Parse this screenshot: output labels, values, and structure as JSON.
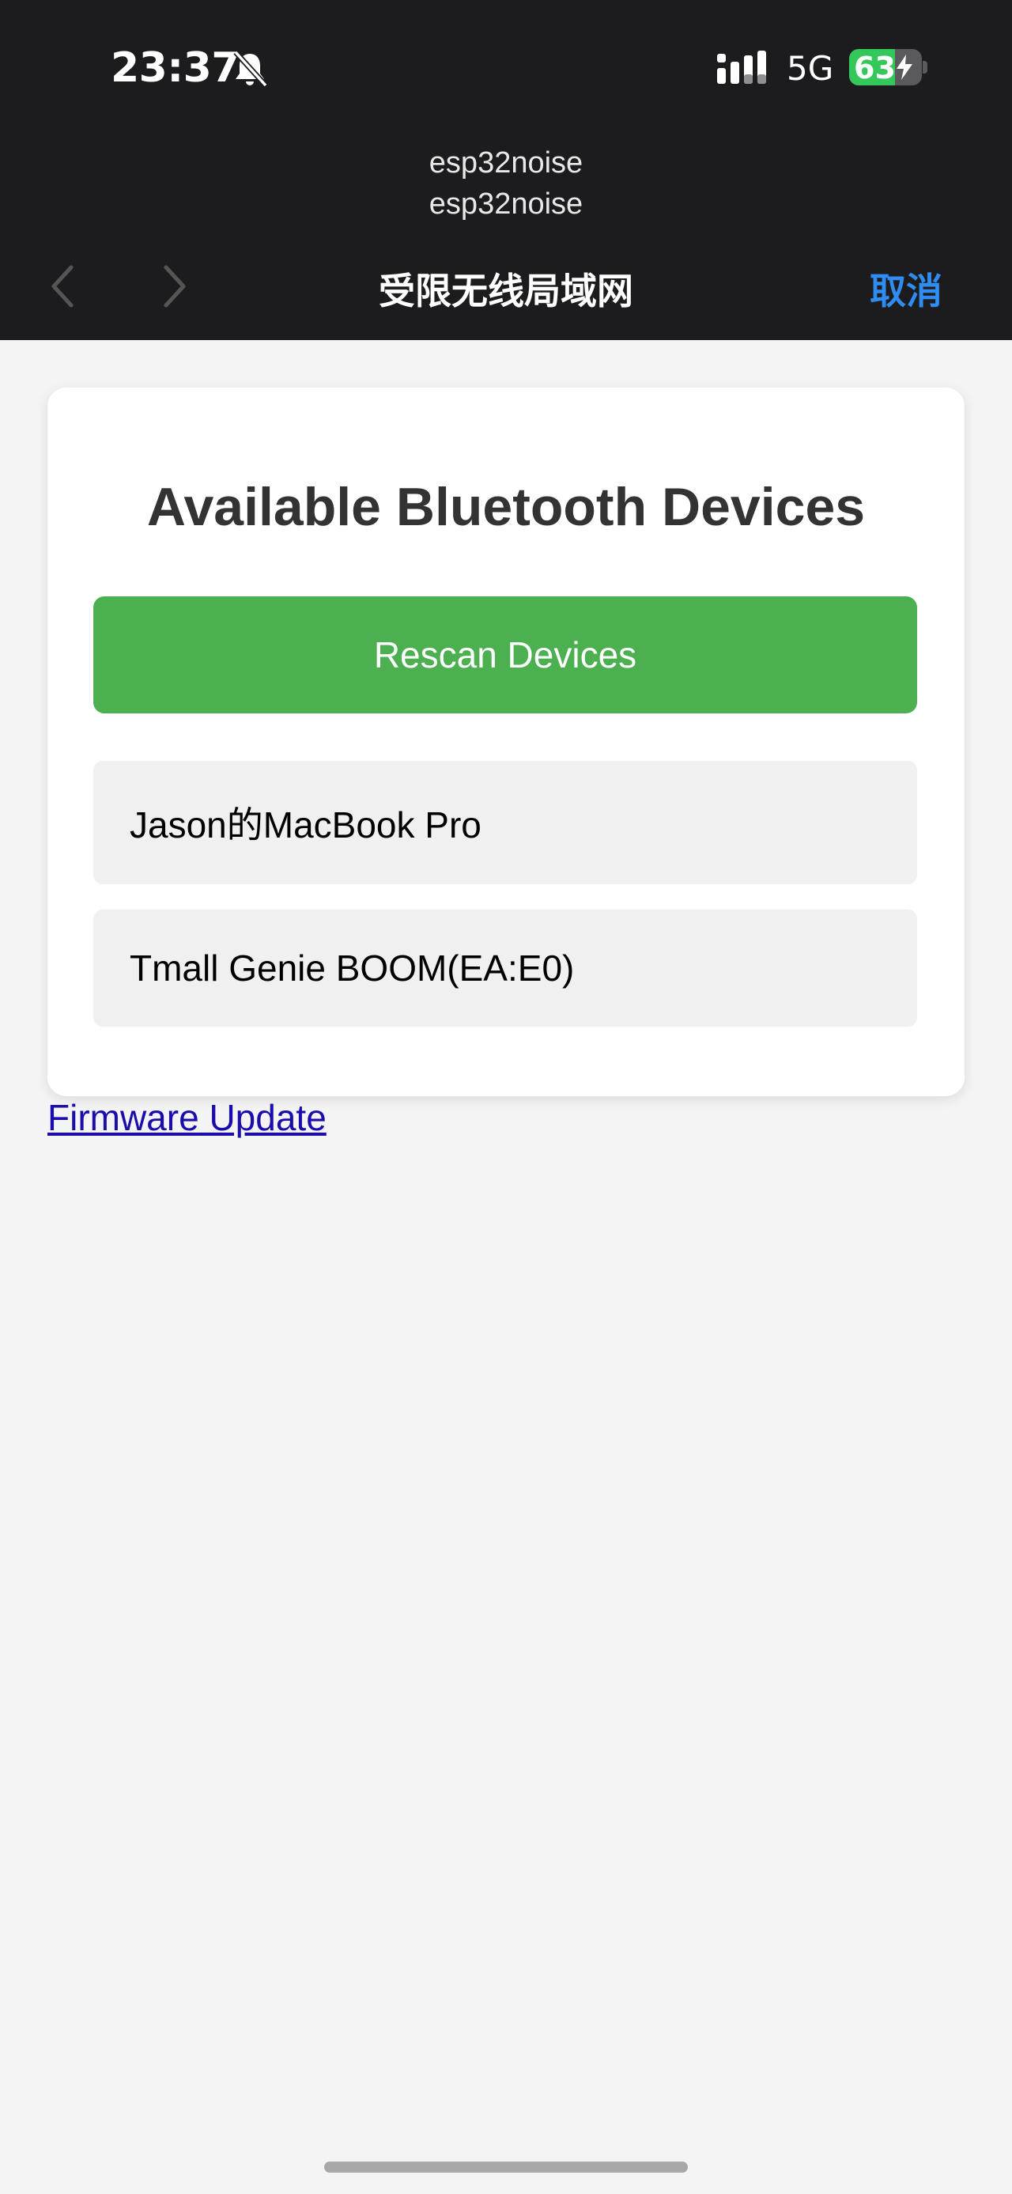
{
  "status_bar": {
    "time": "23:37",
    "network": "5G",
    "battery_percent": "63",
    "battery_level": 0.63,
    "icons": [
      "bell-muted-icon",
      "signal-icon",
      "charging-bolt-icon"
    ]
  },
  "browser": {
    "site_name_line1": "esp32noise",
    "site_name_line2": "esp32noise",
    "title": "受限无线局域网",
    "cancel_label": "取消"
  },
  "card": {
    "title": "Available Bluetooth Devices",
    "rescan_label": "Rescan Devices",
    "devices": [
      {
        "name": "Jason的MacBook Pro"
      },
      {
        "name": "Tmall Genie BOOM(EA:E0)"
      }
    ]
  },
  "firmware_link": "Firmware Update",
  "colors": {
    "header_bg": "#1c1c1e",
    "accent_blue": "#2f8cf0",
    "rescan_green": "#4caf50",
    "battery_green": "#34c759",
    "link": "#1a0dab"
  }
}
